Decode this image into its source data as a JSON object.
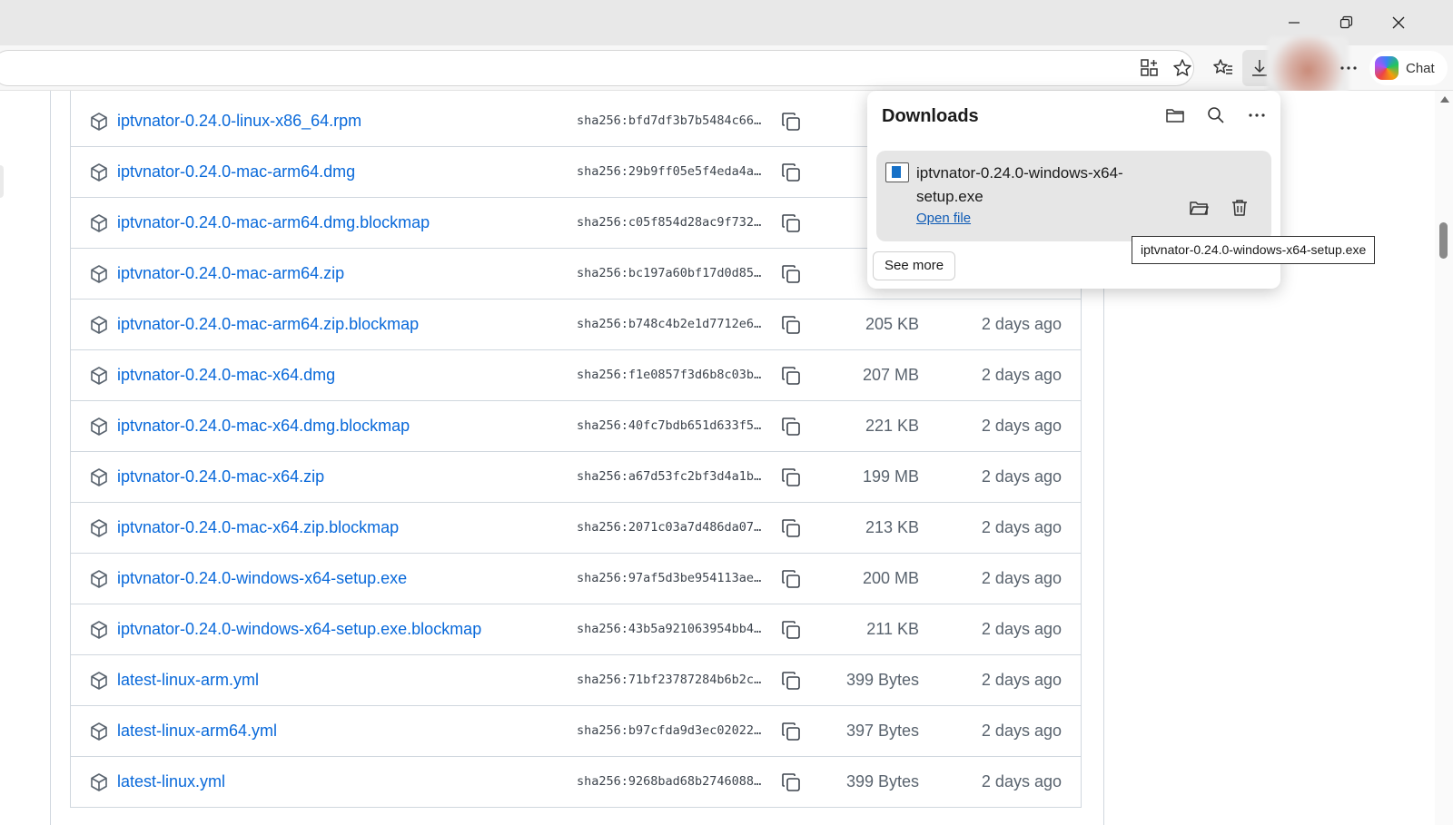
{
  "browser": {
    "chat_label": "Chat",
    "icons": {
      "minimize": "minimize-icon",
      "restore": "restore-icon",
      "close": "close-icon",
      "apps": "app-grid-icon",
      "favorite": "star-icon",
      "favorites": "favorites-list-icon",
      "downloads": "download-icon",
      "more": "ellipsis-icon",
      "copilot": "copilot-logo"
    }
  },
  "assets": [
    {
      "name": "iptvnator-0.24.0-linux-x86_64.rpm",
      "sha": "sha256:bfd7df3b7b5484c66…",
      "size": "",
      "date": ""
    },
    {
      "name": "iptvnator-0.24.0-mac-arm64.dmg",
      "sha": "sha256:29b9ff05e5f4eda4a…",
      "size": "",
      "date": ""
    },
    {
      "name": "iptvnator-0.24.0-mac-arm64.dmg.blockmap",
      "sha": "sha256:c05f854d28ac9f732…",
      "size": "",
      "date": ""
    },
    {
      "name": "iptvnator-0.24.0-mac-arm64.zip",
      "sha": "sha256:bc197a60bf17d0d85…",
      "size": "",
      "date": ""
    },
    {
      "name": "iptvnator-0.24.0-mac-arm64.zip.blockmap",
      "sha": "sha256:b748c4b2e1d7712e6…",
      "size": "205 KB",
      "date": "2 days ago"
    },
    {
      "name": "iptvnator-0.24.0-mac-x64.dmg",
      "sha": "sha256:f1e0857f3d6b8c03b…",
      "size": "207 MB",
      "date": "2 days ago"
    },
    {
      "name": "iptvnator-0.24.0-mac-x64.dmg.blockmap",
      "sha": "sha256:40fc7bdb651d633f5…",
      "size": "221 KB",
      "date": "2 days ago"
    },
    {
      "name": "iptvnator-0.24.0-mac-x64.zip",
      "sha": "sha256:a67d53fc2bf3d4a1b…",
      "size": "199 MB",
      "date": "2 days ago"
    },
    {
      "name": "iptvnator-0.24.0-mac-x64.zip.blockmap",
      "sha": "sha256:2071c03a7d486da07…",
      "size": "213 KB",
      "date": "2 days ago"
    },
    {
      "name": "iptvnator-0.24.0-windows-x64-setup.exe",
      "sha": "sha256:97af5d3be954113ae…",
      "size": "200 MB",
      "date": "2 days ago"
    },
    {
      "name": "iptvnator-0.24.0-windows-x64-setup.exe.blockmap",
      "sha": "sha256:43b5a921063954bb4…",
      "size": "211 KB",
      "date": "2 days ago"
    },
    {
      "name": "latest-linux-arm.yml",
      "sha": "sha256:71bf23787284b6b2c…",
      "size": "399 Bytes",
      "date": "2 days ago"
    },
    {
      "name": "latest-linux-arm64.yml",
      "sha": "sha256:b97cfda9d3ec02022…",
      "size": "397 Bytes",
      "date": "2 days ago"
    },
    {
      "name": "latest-linux.yml",
      "sha": "sha256:9268bad68b2746088…",
      "size": "399 Bytes",
      "date": "2 days ago"
    }
  ],
  "downloads_panel": {
    "title": "Downloads",
    "item": {
      "filename": "iptvnator-0.24.0-windows-x64-setup.exe",
      "filename_line1": "iptvnator-0.24.0-windows-x64-",
      "filename_line2": "setup.exe",
      "open_label": "Open file"
    },
    "see_more_label": "See more",
    "tooltip": "iptvnator-0.24.0-windows-x64-setup.exe"
  }
}
